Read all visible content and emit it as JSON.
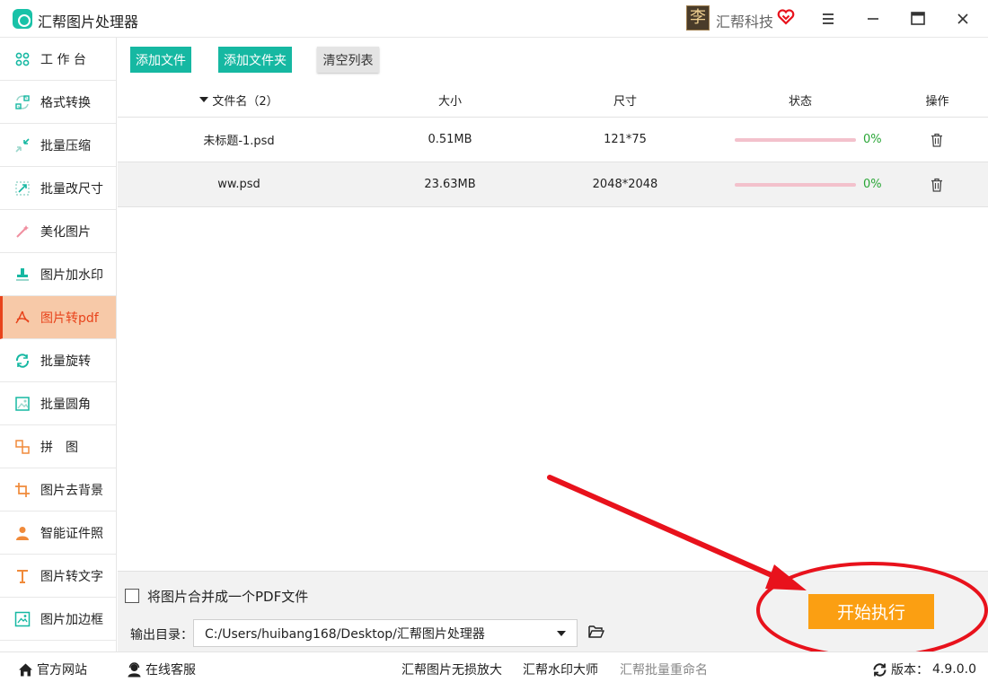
{
  "app": {
    "title": "汇帮图片处理器",
    "user_avatar_char": "李",
    "user_name": "汇帮科技"
  },
  "sidebar": {
    "items": [
      {
        "label": "工 作 台",
        "icon": "grid-icon"
      },
      {
        "label": "格式转换",
        "icon": "convert-icon"
      },
      {
        "label": "批量压缩",
        "icon": "compress-icon"
      },
      {
        "label": "批量改尺寸",
        "icon": "resize-icon"
      },
      {
        "label": "美化图片",
        "icon": "beautify-icon"
      },
      {
        "label": "图片加水印",
        "icon": "stamp-icon"
      },
      {
        "label": "图片转pdf",
        "icon": "pdf-icon",
        "active": true
      },
      {
        "label": "批量旋转",
        "icon": "rotate-icon"
      },
      {
        "label": "批量圆角",
        "icon": "rounded-corner-icon"
      },
      {
        "label": "拼　图",
        "icon": "puzzle-icon"
      },
      {
        "label": "图片去背景",
        "icon": "crop-icon"
      },
      {
        "label": "智能证件照",
        "icon": "person-icon"
      },
      {
        "label": "图片转文字",
        "icon": "text-icon"
      },
      {
        "label": "图片加边框",
        "icon": "frame-icon"
      }
    ]
  },
  "toolbar": {
    "add_file": "添加文件",
    "add_folder": "添加文件夹",
    "clear_list": "清空列表"
  },
  "table": {
    "headers": {
      "name": "文件名（2）",
      "size": "大小",
      "dimensions": "尺寸",
      "status": "状态",
      "action": "操作"
    },
    "rows": [
      {
        "name": "未标题-1.psd",
        "size": "0.51MB",
        "dimensions": "121*75",
        "progress": "0%"
      },
      {
        "name": "ww.psd",
        "size": "23.63MB",
        "dimensions": "2048*2048",
        "progress": "0%"
      }
    ]
  },
  "options": {
    "merge_label": "将图片合并成一个PDF文件",
    "output_label": "输出目录：",
    "output_path": "C:/Users/huibang168/Desktop/汇帮图片处理器",
    "start_button": "开始执行"
  },
  "footer": {
    "website": "官方网站",
    "support": "在线客服",
    "link1": "汇帮图片无损放大",
    "link2": "汇帮水印大师",
    "link3": "汇帮批量重命名",
    "version_label": "版本：",
    "version_value": "4.9.0.0"
  },
  "colors": {
    "accent": "#16b8a2",
    "start": "#fb9f12",
    "active_bg": "#f7c9a8",
    "active_text": "#e8431b",
    "annotation": "#e8121c"
  }
}
